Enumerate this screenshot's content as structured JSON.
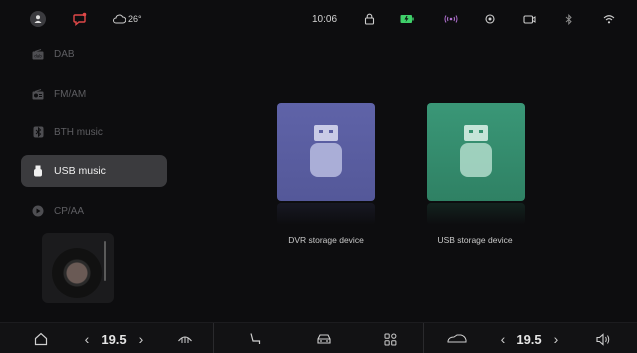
{
  "status_bar": {
    "weather_temp": "26°",
    "time": "10:06"
  },
  "sidebar": {
    "items": [
      {
        "label": "DAB",
        "icon": "radio-dab-icon",
        "active": false
      },
      {
        "label": "FM/AM",
        "icon": "radio-icon",
        "active": false
      },
      {
        "label": "BTH music",
        "icon": "bluetooth-icon",
        "active": false
      },
      {
        "label": "USB music",
        "icon": "usb-icon",
        "active": true
      },
      {
        "label": "CP/AA",
        "icon": "play-circle-icon",
        "active": false
      }
    ]
  },
  "devices": [
    {
      "label": "DVR storage device",
      "icon": "usb-drive-icon",
      "color": "#5b5fa2"
    },
    {
      "label": "USB storage device",
      "icon": "usb-drive-icon",
      "color": "#35906f"
    }
  ],
  "bottom_bar": {
    "left_temp": "19.5",
    "right_temp": "19.5"
  },
  "colors": {
    "background": "#0d0d0f",
    "active_item": "#3b3b3e",
    "dvr_tile": "#5b5fa2",
    "usb_tile": "#35906f",
    "charging": "#3fd06a"
  }
}
